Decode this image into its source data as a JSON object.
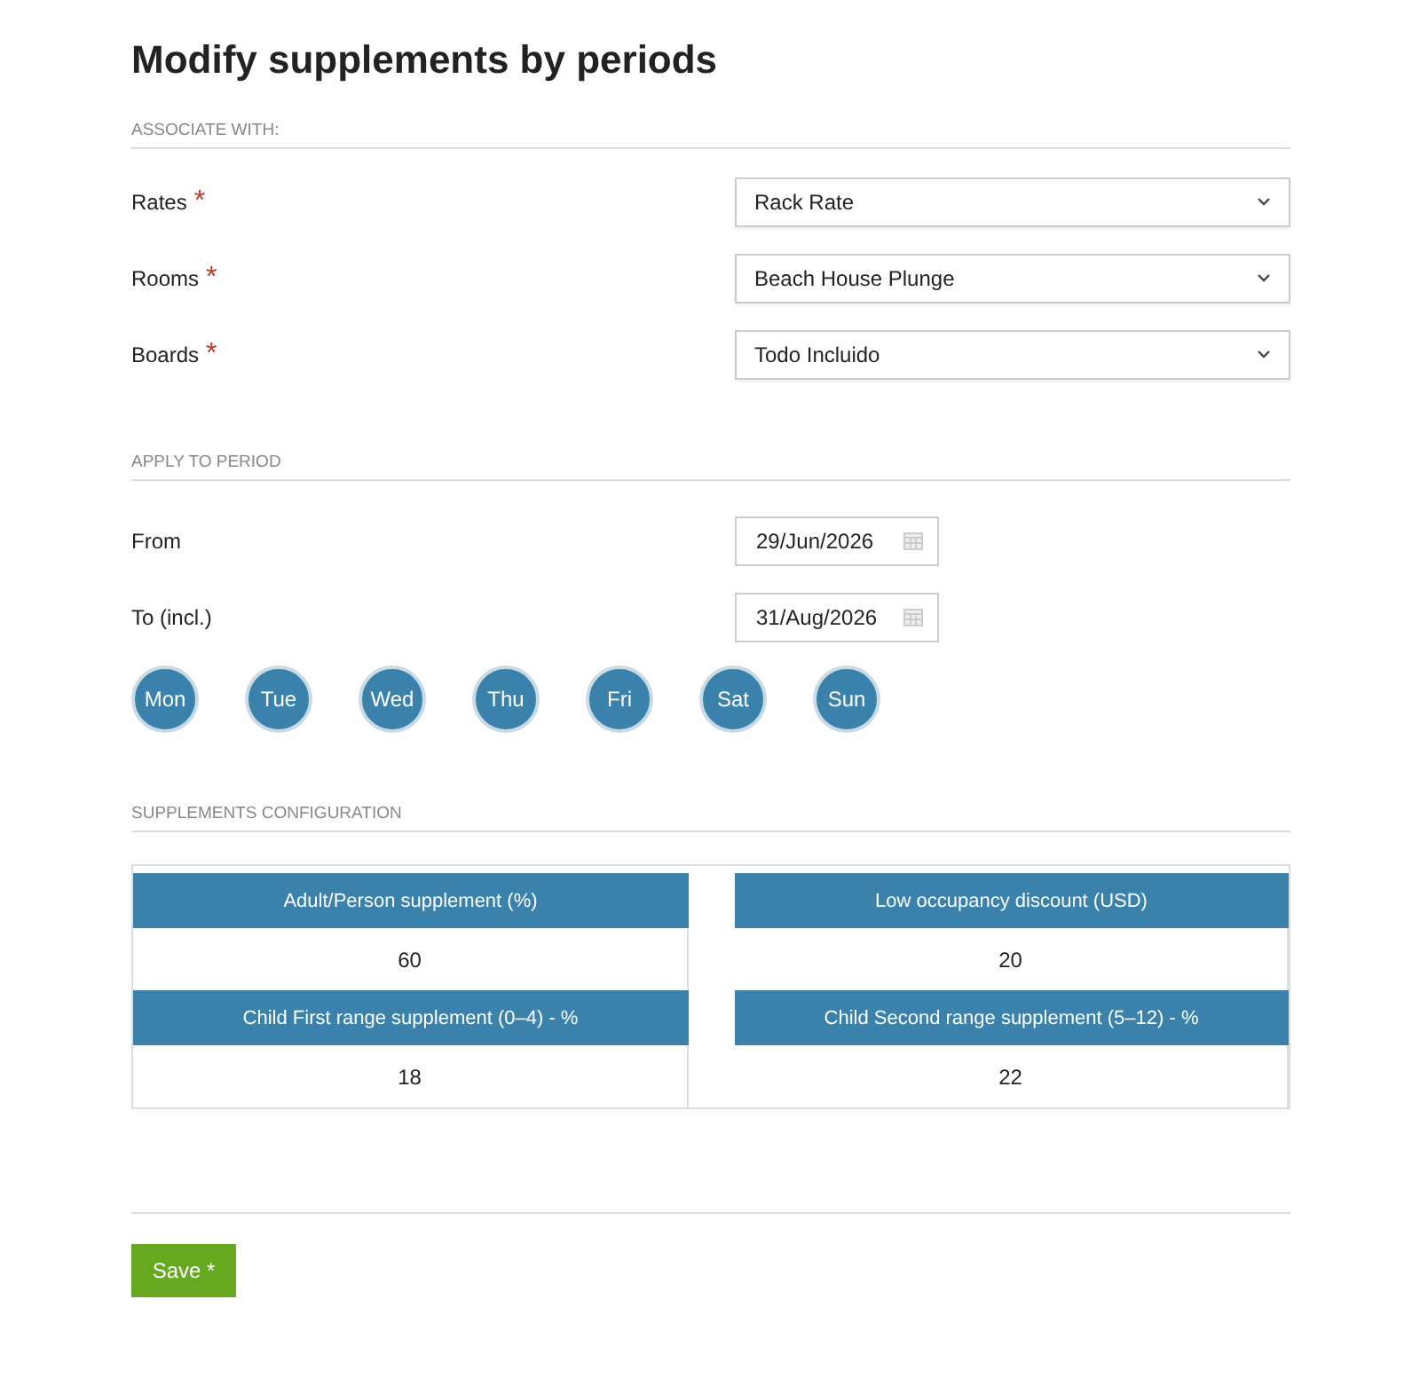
{
  "title": "Modify supplements by periods",
  "associate": {
    "heading": "ASSOCIATE WITH:",
    "fields": [
      {
        "label": "Rates",
        "mark": "*",
        "value": "Rack Rate"
      },
      {
        "label": "Rooms",
        "mark": "*",
        "value": "Beach House Plunge"
      },
      {
        "label": "Boards",
        "mark": "*",
        "value": "Todo Incluido"
      }
    ]
  },
  "period": {
    "heading": "APPLY TO PERIOD",
    "dates": [
      {
        "label": "From",
        "value": "29/Jun/2026"
      },
      {
        "label": "To (incl.)",
        "value": "31/Aug/2026"
      }
    ],
    "days": [
      {
        "label": "Mon",
        "selected": true
      },
      {
        "label": "Tue",
        "selected": true
      },
      {
        "label": "Wed",
        "selected": true
      },
      {
        "label": "Thu",
        "selected": true
      },
      {
        "label": "Fri",
        "selected": true
      },
      {
        "label": "Sat",
        "selected": true
      },
      {
        "label": "Sun",
        "selected": true
      }
    ]
  },
  "supplements": {
    "heading": "SUPPLEMENTS CONFIGURATION",
    "items": [
      {
        "label": "Adult/Person supplement (%)",
        "value": "60"
      },
      {
        "label": "Low occupancy discount (USD)",
        "value": "20"
      },
      {
        "label": "Child First range supplement (0–4) - %",
        "value": "18"
      },
      {
        "label": "Child Second range supplement (5–12) - %",
        "value": "22"
      }
    ]
  },
  "save_button": "Save *"
}
